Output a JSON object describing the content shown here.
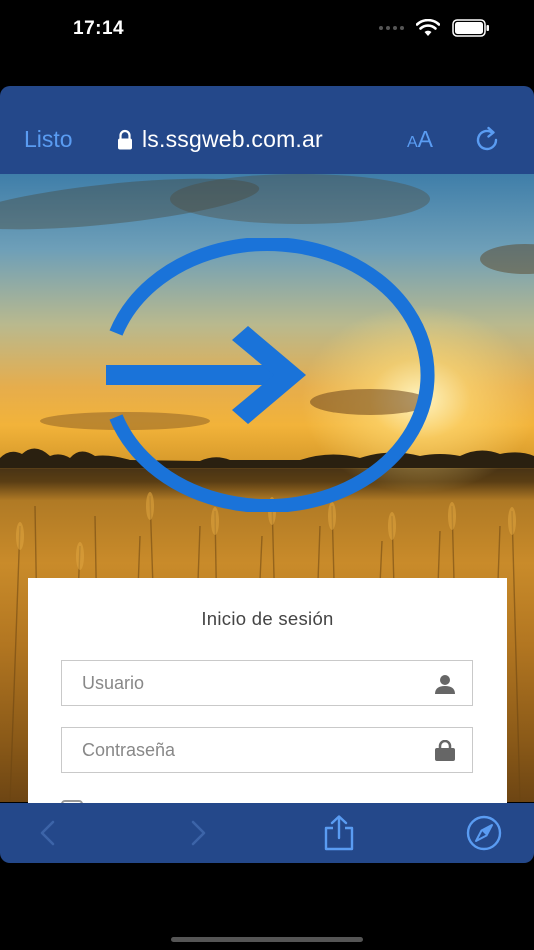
{
  "status_bar": {
    "time": "17:14"
  },
  "browser": {
    "done_label": "Listo",
    "url": "ls.ssgweb.com.ar",
    "text_size_small": "A",
    "text_size_large": "A"
  },
  "login": {
    "title": "Inicio de sesión",
    "username_placeholder": "Usuario",
    "password_placeholder": "Contraseña"
  },
  "colors": {
    "toolbar_bg": "#24488a",
    "accent": "#5a9cf2",
    "login_icon": "#1a73d9"
  },
  "icons": {
    "lock": "lock-icon",
    "reload": "reload-icon",
    "login": "login-arrow-icon",
    "user": "user-icon",
    "password": "padlock-icon",
    "back": "chevron-left-icon",
    "forward": "chevron-right-icon",
    "share": "share-icon",
    "compass": "compass-icon"
  }
}
